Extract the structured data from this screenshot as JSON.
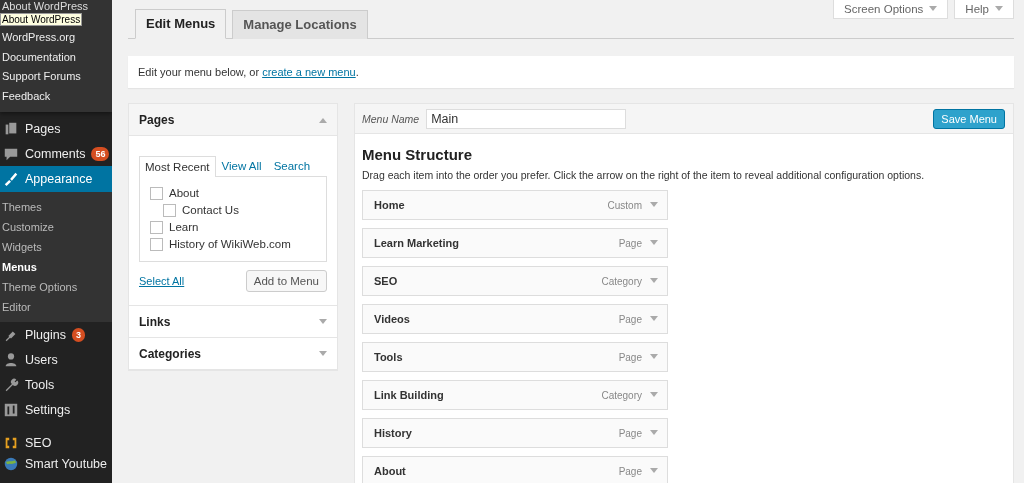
{
  "sidebar": {
    "flyout": {
      "title": "About WordPress",
      "tooltip": "About WordPress",
      "items": [
        "WordPress.org",
        "Documentation",
        "Support Forums",
        "Feedback"
      ]
    },
    "items": [
      {
        "label": "Pages",
        "selected": false
      },
      {
        "label": "Comments",
        "badge": "56",
        "selected": false
      },
      {
        "label": "Appearance",
        "selected": true,
        "children": [
          {
            "label": "Themes",
            "selected": false
          },
          {
            "label": "Customize",
            "selected": false
          },
          {
            "label": "Widgets",
            "selected": false
          },
          {
            "label": "Menus",
            "selected": true
          },
          {
            "label": "Theme Options",
            "selected": false
          },
          {
            "label": "Editor",
            "selected": false
          }
        ]
      },
      {
        "label": "Plugins",
        "badge": "3",
        "selected": false
      },
      {
        "label": "Users",
        "selected": false
      },
      {
        "label": "Tools",
        "selected": false
      },
      {
        "label": "Settings",
        "selected": false
      },
      {
        "label": "SEO",
        "selected": false
      },
      {
        "label": "Smart Youtube",
        "selected": false
      }
    ]
  },
  "screen_meta": [
    "Screen Options",
    "Help"
  ],
  "tabs": [
    {
      "label": "Edit Menus",
      "selected": true
    },
    {
      "label": "Manage Locations",
      "selected": false
    }
  ],
  "notice": {
    "text": "Edit your menu below, or ",
    "link": "create a new menu",
    "end": "."
  },
  "accordion": [
    {
      "title": "Pages",
      "expanded": true,
      "tabs": [
        {
          "label": "Most Recent",
          "selected": true
        },
        {
          "label": "View All",
          "selected": false
        },
        {
          "label": "Search",
          "selected": false
        }
      ],
      "pages": [
        {
          "label": "About",
          "checked": false,
          "children": [
            {
              "label": "Contact Us",
              "checked": false
            }
          ]
        },
        {
          "label": "Learn",
          "checked": false
        },
        {
          "label": "History of WikiWeb.com",
          "checked": false
        }
      ],
      "select_all": "Select All",
      "add_button": "Add to Menu"
    },
    {
      "title": "Links",
      "expanded": false
    },
    {
      "title": "Categories",
      "expanded": false
    }
  ],
  "menu_editor": {
    "name_label": "Menu Name",
    "name_value": "Main",
    "save_button": "Save Menu",
    "heading": "Menu Structure",
    "instructions": "Drag each item into the order you prefer. Click the arrow on the right of the item to reveal additional configuration options.",
    "items": [
      {
        "title": "Home",
        "type": "Custom"
      },
      {
        "title": "Learn Marketing",
        "type": "Page"
      },
      {
        "title": "SEO",
        "type": "Category"
      },
      {
        "title": "Videos",
        "type": "Page"
      },
      {
        "title": "Tools",
        "type": "Page"
      },
      {
        "title": "Link Building",
        "type": "Category"
      },
      {
        "title": "History",
        "type": "Page"
      },
      {
        "title": "About",
        "type": "Page"
      }
    ]
  }
}
